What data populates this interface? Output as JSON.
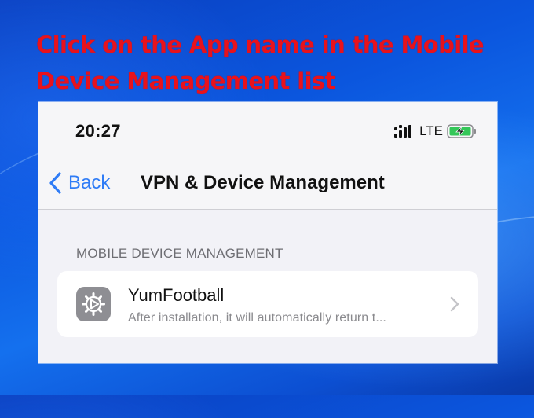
{
  "instruction": {
    "line1": "Click on the App name in the Mobile",
    "line2": "Device Management list"
  },
  "status_bar": {
    "time": "20:27",
    "network": "LTE",
    "icons": [
      "signal-icon",
      "battery-charging-icon"
    ]
  },
  "nav": {
    "back_label": "Back",
    "title": "VPN & Device Management"
  },
  "section": {
    "header": "MOBILE DEVICE MANAGEMENT",
    "items": [
      {
        "name": "YumFootball",
        "description": "After installation, it will automatically return t...",
        "icon": "settings-gear-icon"
      }
    ]
  },
  "colors": {
    "instruction_text": "#e8121c",
    "link_blue": "#2f7cf6",
    "background_blue": "#0b56de",
    "battery_green": "#34c759"
  }
}
